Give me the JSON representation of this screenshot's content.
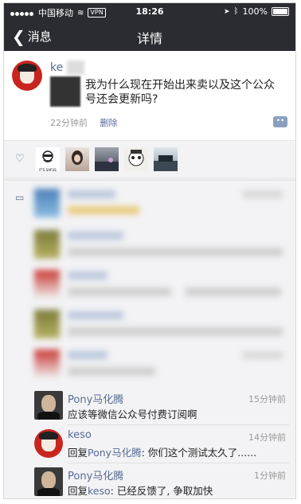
{
  "status": {
    "carrier": "中国移动",
    "vpn": "VPN",
    "time": "18:26",
    "battery": "100%"
  },
  "nav": {
    "back_label": "消息",
    "title": "详情"
  },
  "post": {
    "author": "ke",
    "text": "我为什么现在开始出来卖以及这个公众号还会更新吗?",
    "time": "22分钟前",
    "delete_label": "删除"
  },
  "likes": {
    "icon": "heart-icon",
    "first_avatar_caption": "IT'S SAFUS"
  },
  "comments": {
    "icon": "comment-icon",
    "visible": [
      {
        "name": "Pony马化腾",
        "text": "应该等微信公众号付费订阅啊",
        "time": "15分钟前",
        "avatar": "pony"
      },
      {
        "name": "keso",
        "reply_prefix": "回复",
        "reply_to": "Pony马化腾",
        "text": ": 你们这个测试太久了......",
        "time": "14分钟前",
        "avatar": "keso"
      },
      {
        "name": "Pony马化腾",
        "reply_prefix": "回复",
        "reply_to": "keso",
        "text": ": 已经反馈了, 争取加快",
        "time": "1分钟前",
        "avatar": "pony"
      }
    ]
  },
  "colors": {
    "bar_bg": "#2b2c31",
    "link": "#576b95",
    "comment_bg": "#f3f3f5"
  }
}
